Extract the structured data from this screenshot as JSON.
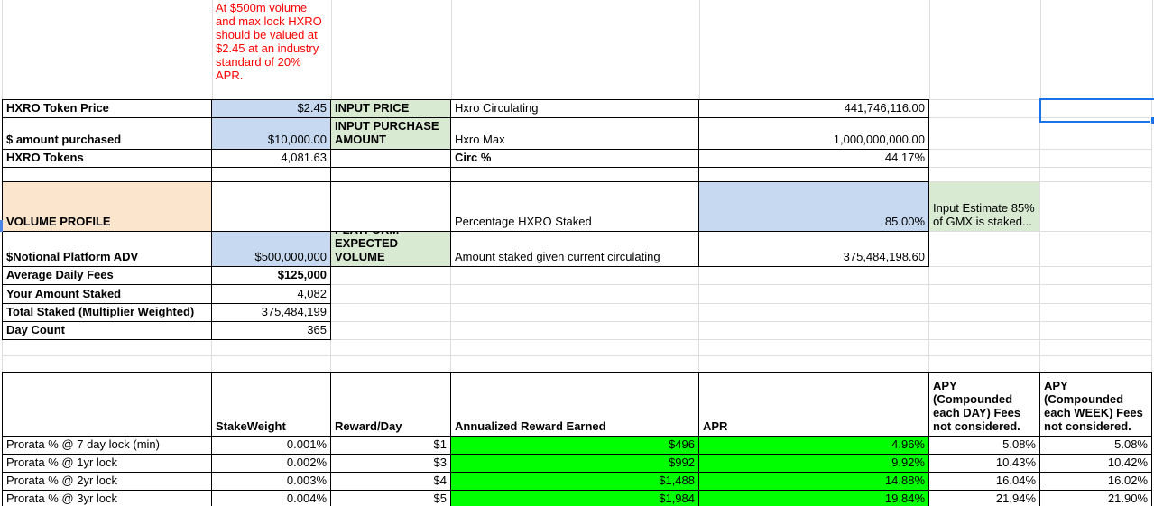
{
  "note": {
    "text": "At $500m volume and max lock HXRO should be valued at $2.45 at an industry standard of 20% APR."
  },
  "token": {
    "price_label": "HXRO Token Price",
    "price_value": "$2.45",
    "price_tag": "INPUT PRICE",
    "purchase_label": "$ amount purchased",
    "purchase_value": "$10,000.00",
    "purchase_tag": "INPUT PURCHASE AMOUNT",
    "tokens_label": "HXRO Tokens",
    "tokens_value": "4,081.63"
  },
  "supply": {
    "circulating_label": "Hxro Circulating",
    "circulating_value": "441,746,116.00",
    "max_label": "Hxro Max",
    "max_value": "1,000,000,000.00",
    "circ_pct_label": "Circ %",
    "circ_pct_value": "44.17%"
  },
  "staking": {
    "pct_label": "Percentage HXRO Staked",
    "pct_value": "85.00%",
    "pct_note": "Input Estimate 85% of GMX is staked...",
    "amount_label": "Amount staked given current circulating",
    "amount_value": "375,484,198.60"
  },
  "volume": {
    "section_label": "VOLUME PROFILE",
    "adv_label": "$Notional Platform ADV",
    "adv_value": "$500,000,000",
    "adv_tag": "PLATFORM EXPECTED VOLUME",
    "fees_label": "Average Daily Fees",
    "fees_value": "$125,000",
    "your_staked_label": "Your Amount Staked",
    "your_staked_value": "4,082",
    "total_staked_label": "Total Staked (Multiplier Weighted)",
    "total_staked_value": "375,484,199",
    "day_count_label": "Day Count",
    "day_count_value": "365"
  },
  "lock_table": {
    "headers": [
      "StakeWeight",
      "Reward/Day",
      "Annualized Reward Earned",
      "APR",
      "APY (Compounded each DAY) Fees not considered.",
      "APY (Compounded each WEEK) Fees not considered."
    ],
    "rows": [
      [
        "Prorata % @ 7 day lock (min)",
        "0.001%",
        "$1",
        "$496",
        "4.96%",
        "5.08%",
        "5.08%"
      ],
      [
        "Prorata % @ 1yr lock",
        "0.002%",
        "$3",
        "$992",
        "9.92%",
        "10.43%",
        "10.42%"
      ],
      [
        "Prorata % @ 2yr lock",
        "0.003%",
        "$4",
        "$1,488",
        "14.88%",
        "16.04%",
        "16.02%"
      ],
      [
        "Prorata % @ 3yr lock",
        "0.004%",
        "$5",
        "$1,984",
        "19.84%",
        "21.94%",
        "21.90%"
      ]
    ]
  },
  "colors": {
    "input_fill_blue": "#c6d9f1",
    "tag_fill_green": "#d9ead3",
    "section_fill_orange": "#fce5cd",
    "highlight_green": "#00ff00",
    "note_text_red": "#ff0000",
    "selection_blue": "#1a73e8"
  }
}
